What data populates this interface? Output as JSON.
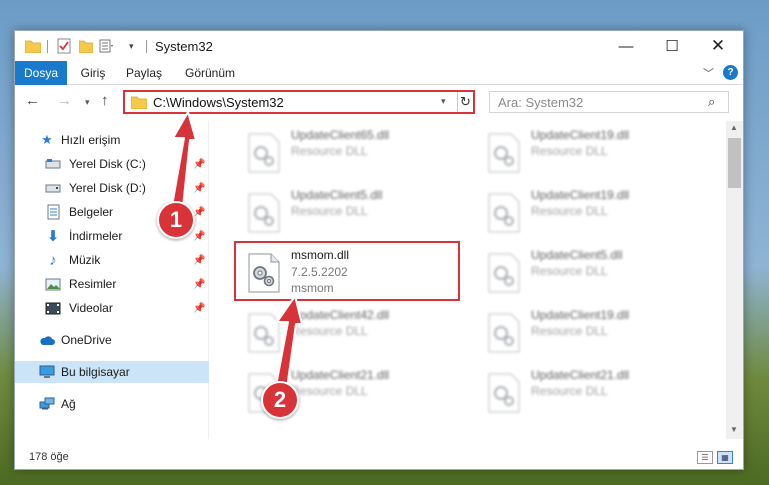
{
  "window": {
    "title": "System32",
    "controls": {
      "minimize": "—",
      "maximize": "☐",
      "close": "✕"
    }
  },
  "ribbon": {
    "tabs": [
      "Dosya",
      "Giriş",
      "Paylaş",
      "Görünüm"
    ]
  },
  "navigation": {
    "address": "C:\\Windows\\System32",
    "search_placeholder": "Ara: System32"
  },
  "sidebar": {
    "items": [
      {
        "label": "Hızlı erişim",
        "icon": "star-icon",
        "pinned": false
      },
      {
        "label": "Yerel Disk (C:)",
        "icon": "drive-icon",
        "pinned": true
      },
      {
        "label": "Yerel Disk (D:)",
        "icon": "drive-icon",
        "pinned": true
      },
      {
        "label": "Belgeler",
        "icon": "documents-icon",
        "pinned": true
      },
      {
        "label": "İndirmeler",
        "icon": "download-icon",
        "pinned": true
      },
      {
        "label": "Müzik",
        "icon": "music-icon",
        "pinned": true
      },
      {
        "label": "Resimler",
        "icon": "pictures-icon",
        "pinned": true
      },
      {
        "label": "Videolar",
        "icon": "videos-icon",
        "pinned": true
      },
      {
        "label": "OneDrive",
        "icon": "cloud-icon",
        "pinned": false
      },
      {
        "label": "Bu bilgisayar",
        "icon": "computer-icon",
        "pinned": false,
        "selected": true
      },
      {
        "label": "Ağ",
        "icon": "network-icon",
        "pinned": false
      }
    ]
  },
  "files": {
    "left": [
      {
        "name": "UpdateClient65.dll",
        "version": "",
        "desc": "Resource DLL",
        "blurred": true
      },
      {
        "name": "UpdateClient5.dll",
        "version": "",
        "desc": "Resource DLL",
        "blurred": true
      },
      {
        "name": "msmom.dll",
        "version": "7.2.5.2202",
        "desc": "msmom",
        "blurred": false
      },
      {
        "name": "UpdateClient42.dll",
        "version": "",
        "desc": "Resource DLL",
        "blurred": true
      },
      {
        "name": "UpdateClient21.dll",
        "version": "",
        "desc": "Resource DLL",
        "blurred": true
      }
    ],
    "right": [
      {
        "name": "UpdateClient19.dll",
        "version": "",
        "desc": "Resource DLL",
        "blurred": true
      },
      {
        "name": "UpdateClient19.dll",
        "version": "",
        "desc": "Resource DLL",
        "blurred": true
      },
      {
        "name": "UpdateClient5.dll",
        "version": "",
        "desc": "Resource DLL",
        "blurred": true
      },
      {
        "name": "UpdateClient19.dll",
        "version": "",
        "desc": "Resource DLL",
        "blurred": true
      },
      {
        "name": "UpdateClient21.dll",
        "version": "",
        "desc": "Resource DLL",
        "blurred": true
      }
    ]
  },
  "status": {
    "item_count": "178 öğe"
  },
  "annotations": {
    "step1": "1",
    "step2": "2",
    "color": "#d9333a"
  },
  "colors": {
    "accent": "#1979ca",
    "selection": "#cce4f7",
    "highlight": "#d9333a"
  }
}
